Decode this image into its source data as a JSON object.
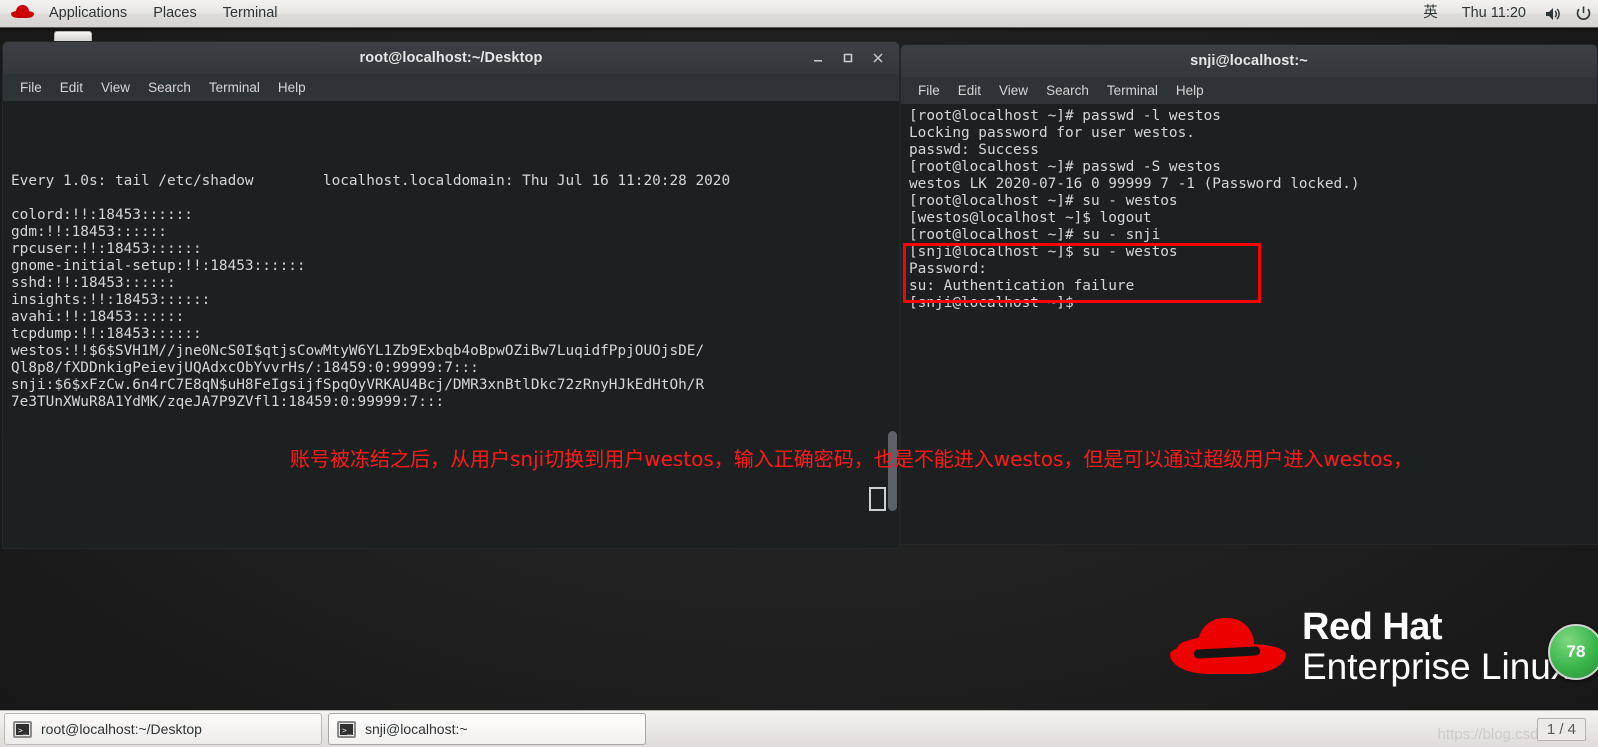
{
  "topbar": {
    "logo_name": "red-hat-logo",
    "menus": [
      "Applications",
      "Places",
      "Terminal"
    ],
    "input_method": "英",
    "clock": "Thu 11:20",
    "volume_icon": "volume-icon",
    "power_icon": "power-icon"
  },
  "left_window": {
    "title": "root@localhost:~/Desktop",
    "menus": [
      "File",
      "Edit",
      "View",
      "Search",
      "Terminal",
      "Help"
    ],
    "buttons": {
      "minimize": "minimize-button",
      "maximize": "maximize-button",
      "close": "close-button"
    },
    "lines": [
      "Every 1.0s: tail /etc/shadow        localhost.localdomain: Thu Jul 16 11:20:28 2020",
      "",
      "colord:!!:18453::::::",
      "gdm:!!:18453::::::",
      "rpcuser:!!:18453::::::",
      "gnome-initial-setup:!!:18453::::::",
      "sshd:!!:18453::::::",
      "insights:!!:18453::::::",
      "avahi:!!:18453::::::",
      "tcpdump:!!:18453::::::",
      "westos:!!$6$SVH1M//jne0NcS0I$qtjsCowMtyW6YL1Zb9Exbqb4oBpwOZiBw7LuqidfPpjOUOjsDE/",
      "Ql8p8/fXDDnkigPeievjUQAdxcObYvvrHs/:18459:0:99999:7:::",
      "snji:$6$xFzCw.6n4rC7E8qN$uH8FeIgsijfSpqOyVRKAU4Bcj/DMR3xnBtlDkc72zRnyHJkEdHtOh/R",
      "7e3TUnXWuR8A1YdMK/zqeJA7P9ZVfl1:18459:0:99999:7:::"
    ]
  },
  "right_window": {
    "title": "snji@localhost:~",
    "menus": [
      "File",
      "Edit",
      "View",
      "Search",
      "Terminal",
      "Help"
    ],
    "lines": [
      "[root@localhost ~]# passwd -l westos",
      "Locking password for user westos.",
      "passwd: Success",
      "[root@localhost ~]# passwd -S westos",
      "westos LK 2020-07-16 0 99999 7 -1 (Password locked.)",
      "[root@localhost ~]# su - westos",
      "[westos@localhost ~]$ logout",
      "[root@localhost ~]# su - snji",
      "[snji@localhost ~]$ su - westos",
      "Password:",
      "su: Authentication failure",
      "[snji@localhost ~]$"
    ],
    "highlight_color": "#ff0000"
  },
  "annotation": {
    "text": "账号被冻结之后，从用户snji切换到用户westos，输入正确密码，也是不能进入westos，但是可以通过超级用户进入westos，",
    "color": "#ff1a1a"
  },
  "branding": {
    "line1": "Red Hat",
    "line2": "Enterprise Linux",
    "badge": "78"
  },
  "taskbar": {
    "tasks": [
      {
        "label": "root@localhost:~/Desktop",
        "icon": "terminal-icon",
        "active": false
      },
      {
        "label": "snji@localhost:~",
        "icon": "terminal-icon",
        "active": true
      }
    ],
    "watermark": "https://blog.csdn.net/S",
    "workspace": "1 / 4"
  }
}
